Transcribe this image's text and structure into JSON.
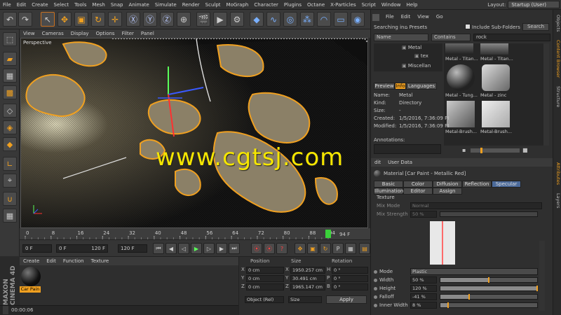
{
  "menubar": {
    "items": [
      "File",
      "Edit",
      "Create",
      "Select",
      "Tools",
      "Mesh",
      "Snap",
      "Animate",
      "Simulate",
      "Render",
      "Sculpt",
      "MoGraph",
      "Character",
      "Plugins",
      "Octane",
      "X-Particles",
      "Script",
      "Window",
      "Help"
    ],
    "layout_label": "Layout:",
    "layout_value": "Startup (User)"
  },
  "viewport_menu": [
    "View",
    "Cameras",
    "Display",
    "Options",
    "Filter",
    "Panel"
  ],
  "viewport": {
    "name": "Perspective",
    "watermark": "www.cgtsj.com"
  },
  "timeline": {
    "ticks": [
      "0",
      "8",
      "16",
      "24",
      "32",
      "40",
      "48",
      "56",
      "64",
      "72",
      "80",
      "88",
      "94"
    ],
    "current_frame": "94",
    "end_label": "94 F"
  },
  "transport": {
    "start": "0 F",
    "min": "0 F",
    "max": "120 F",
    "end": "120 F"
  },
  "material_panel": {
    "menu": [
      "Create",
      "Edit",
      "Function",
      "Texture"
    ],
    "material_name": "Car Pain",
    "logo": "MAXON CINEMA 4D"
  },
  "coordinates": {
    "headers": [
      "Position",
      "Size",
      "Rotation"
    ],
    "rows": [
      {
        "axis": "X",
        "pos": "0 cm",
        "size_axis": "X",
        "size": "1950.257 cm",
        "rot_axis": "H",
        "rot": "0 °"
      },
      {
        "axis": "Y",
        "pos": "0 cm",
        "size_axis": "Y",
        "size": "30.491 cm",
        "rot_axis": "P",
        "rot": "0 °"
      },
      {
        "axis": "Z",
        "pos": "0 cm",
        "size_axis": "Z",
        "size": "1965.147 cm",
        "rot_axis": "B",
        "rot": "0 °"
      }
    ],
    "mode": "Object (Rel)",
    "size_mode": "Size",
    "apply": "Apply"
  },
  "statusbar": {
    "time": "00:00:06"
  },
  "content_browser": {
    "menu": [
      "File",
      "Edit",
      "View",
      "Go"
    ],
    "searching_label": "Searching in:",
    "search_location": "Presets",
    "include_sub": "Include Sub-Folders",
    "search_button": "Search",
    "name_dropdown": "Name",
    "contains_dropdown": "Contains",
    "query": "rock",
    "tree": [
      "Metal",
      "tex",
      "Miscellan"
    ],
    "thumbs": [
      "Metal - Titan...",
      "Metal - Titan...",
      "Metal - Tung...",
      "Metal - zinc",
      "Metal-Brush...",
      "Metal-Brush..."
    ],
    "tabs": [
      "Preview",
      "Info",
      "Languages"
    ],
    "info": [
      {
        "label": "Name:",
        "value": "Metal"
      },
      {
        "label": "Kind:",
        "value": "Directory"
      },
      {
        "label": "Size:",
        "value": "-"
      },
      {
        "label": "Created:",
        "value": "1/5/2016, 7:36:09 PI"
      },
      {
        "label": "Modified:",
        "value": "1/5/2016, 7:36:09 PI"
      }
    ],
    "annotations_label": "Annotations:"
  },
  "attributes": {
    "menu": [
      "dit",
      "User Data"
    ],
    "title": "Material [Car Paint - Metallic Red]",
    "tabs_row1": [
      "Basic",
      "Color",
      "Diffusion",
      "Reflection",
      "Specular"
    ],
    "tabs_row2": [
      "Illumination",
      "Editor",
      "Assign"
    ],
    "active_tab": "Specular",
    "texture_label": "Texture",
    "mix_mode_label": "Mix Mode",
    "mix_mode_value": "Normal",
    "mix_strength_label": "Mix Strength",
    "mix_strength_value": "50 %",
    "props": [
      {
        "label": "Mode",
        "value": "Plastic",
        "level": null
      },
      {
        "label": "Width",
        "value": "50 %",
        "level": 0.5
      },
      {
        "label": "Height",
        "value": "120 %",
        "level": 1.0
      },
      {
        "label": "Falloff",
        "value": "-41 %",
        "level": 0.3
      },
      {
        "label": "Inner Width",
        "value": "8 %",
        "level": 0.08
      }
    ]
  },
  "side_tabs": [
    "Objects",
    "Content Browser",
    "Structure",
    "Attributes",
    "Layers"
  ],
  "colors": {
    "accent": "#f0a020",
    "active_tab": "#4b6a9a",
    "watermark": "#f5e600"
  }
}
